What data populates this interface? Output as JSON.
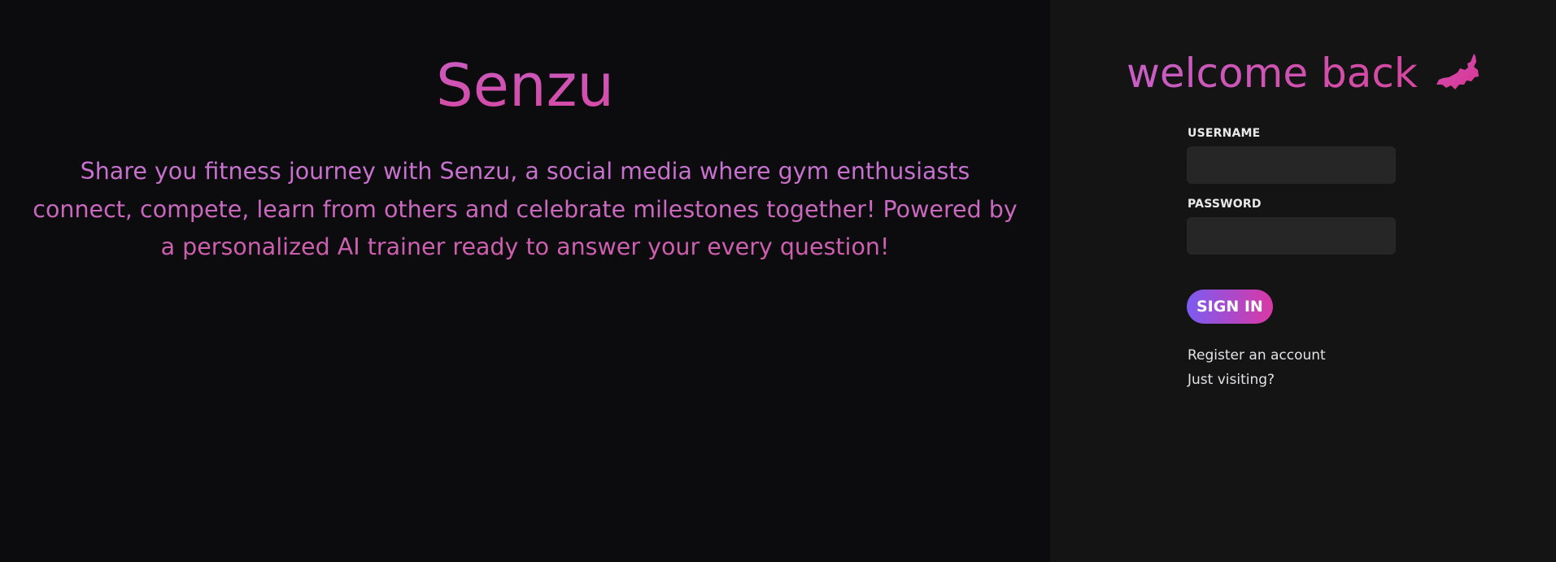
{
  "hero": {
    "title": "Senzu",
    "description": "Share you fitness journey with Senzu, a social media where gym enthusiasts connect, compete, learn from others and celebrate milestones together! Powered by a personalized AI trainer ready to answer your every question!"
  },
  "login": {
    "heading": "welcome back",
    "heading_icon": "bat-icon",
    "username_label": "USERNAME",
    "username_value": "",
    "password_label": "PASSWORD",
    "password_value": "",
    "signin_label": "SIGN IN",
    "register_link": "Register an account",
    "visiting_link": "Just visiting?"
  },
  "colors": {
    "accent_pink": "#d7479f",
    "accent_purple": "#c676d6",
    "button_gradient_start": "#7b5cf0",
    "button_gradient_end": "#d938a5",
    "left_background": "#0c0c0e",
    "right_background": "#141415",
    "input_background": "#262627"
  }
}
